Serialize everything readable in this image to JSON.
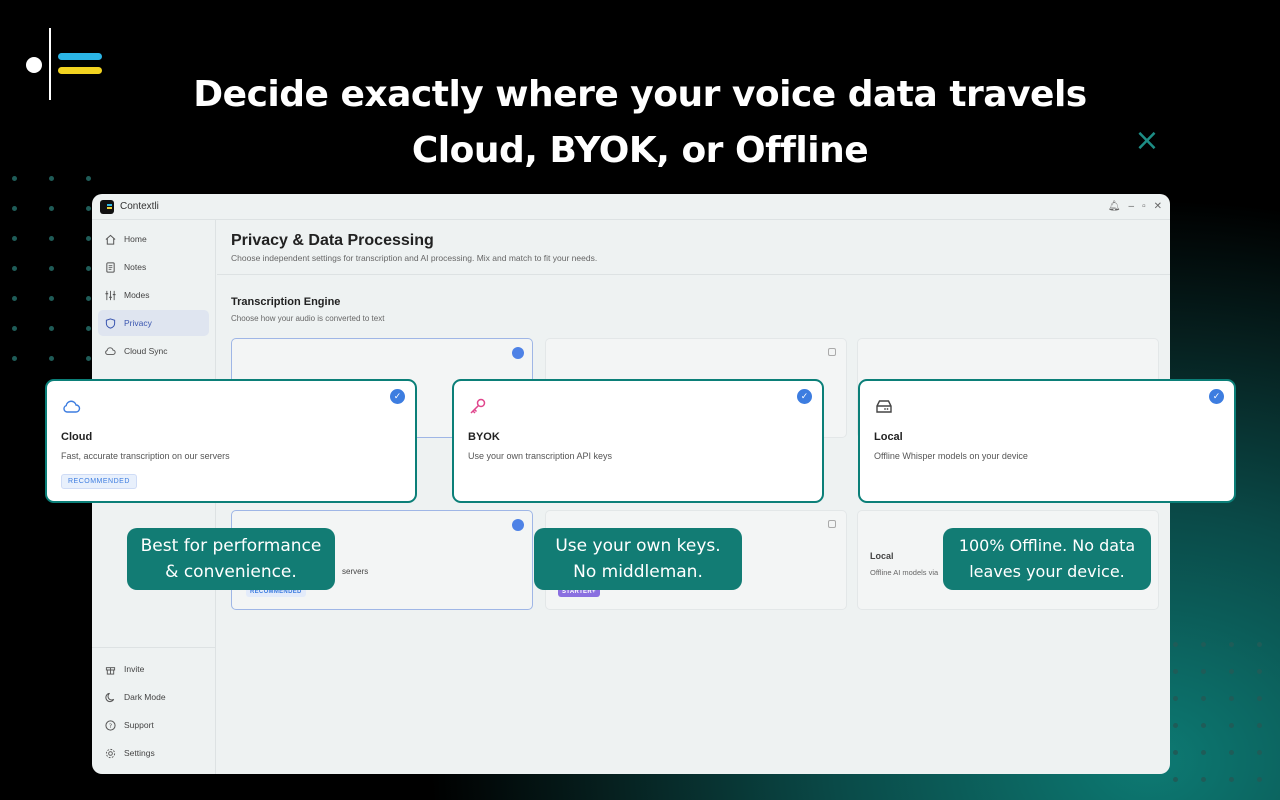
{
  "headline": {
    "line1": "Decide exactly where your voice data travels",
    "line2": "Cloud, BYOK, or Offline"
  },
  "colors": {
    "accent": "#127c74",
    "selected": "#3d7de0",
    "byok_key": "#e0458c"
  },
  "window": {
    "app_name": "Contextli",
    "sidebar": {
      "items": [
        {
          "label": "Home",
          "icon": "home-icon"
        },
        {
          "label": "Notes",
          "icon": "notes-icon"
        },
        {
          "label": "Modes",
          "icon": "sliders-icon"
        },
        {
          "label": "Privacy",
          "icon": "shield-icon",
          "active": true
        },
        {
          "label": "Cloud Sync",
          "icon": "cloud-icon"
        }
      ],
      "bottom_items": [
        {
          "label": "Invite",
          "icon": "gift-icon"
        },
        {
          "label": "Dark Mode",
          "icon": "moon-icon"
        },
        {
          "label": "Support",
          "icon": "help-icon"
        },
        {
          "label": "Settings",
          "icon": "gear-icon"
        }
      ]
    },
    "page": {
      "title": "Privacy & Data Processing",
      "subtitle": "Choose independent settings for transcription and AI processing. Mix and match to fit your needs.",
      "section_title": "Transcription Engine",
      "section_subtitle": "Choose how your audio is converted to text",
      "ai_cards": {
        "cloud_desc": "servers",
        "cloud_badge": "RECOMMENDED",
        "byok_badge": "STARTER+",
        "local_title": "Local",
        "local_desc": "Offline AI models via"
      }
    }
  },
  "cards": [
    {
      "title": "Cloud",
      "desc": "Fast, accurate transcription on our servers",
      "badge": "RECOMMENDED",
      "icon": "cloud-icon"
    },
    {
      "title": "BYOK",
      "desc": "Use your own transcription API keys",
      "icon": "key-icon"
    },
    {
      "title": "Local",
      "desc": "Offline Whisper models on your device",
      "icon": "drive-icon"
    }
  ],
  "callouts": {
    "cloud": {
      "line1": "Best for performance",
      "line2": "& convenience."
    },
    "byok": {
      "line1": "Use your own keys.",
      "line2": "No middleman."
    },
    "local": {
      "line1": "100% Offline. No data",
      "line2": "leaves your device."
    }
  }
}
